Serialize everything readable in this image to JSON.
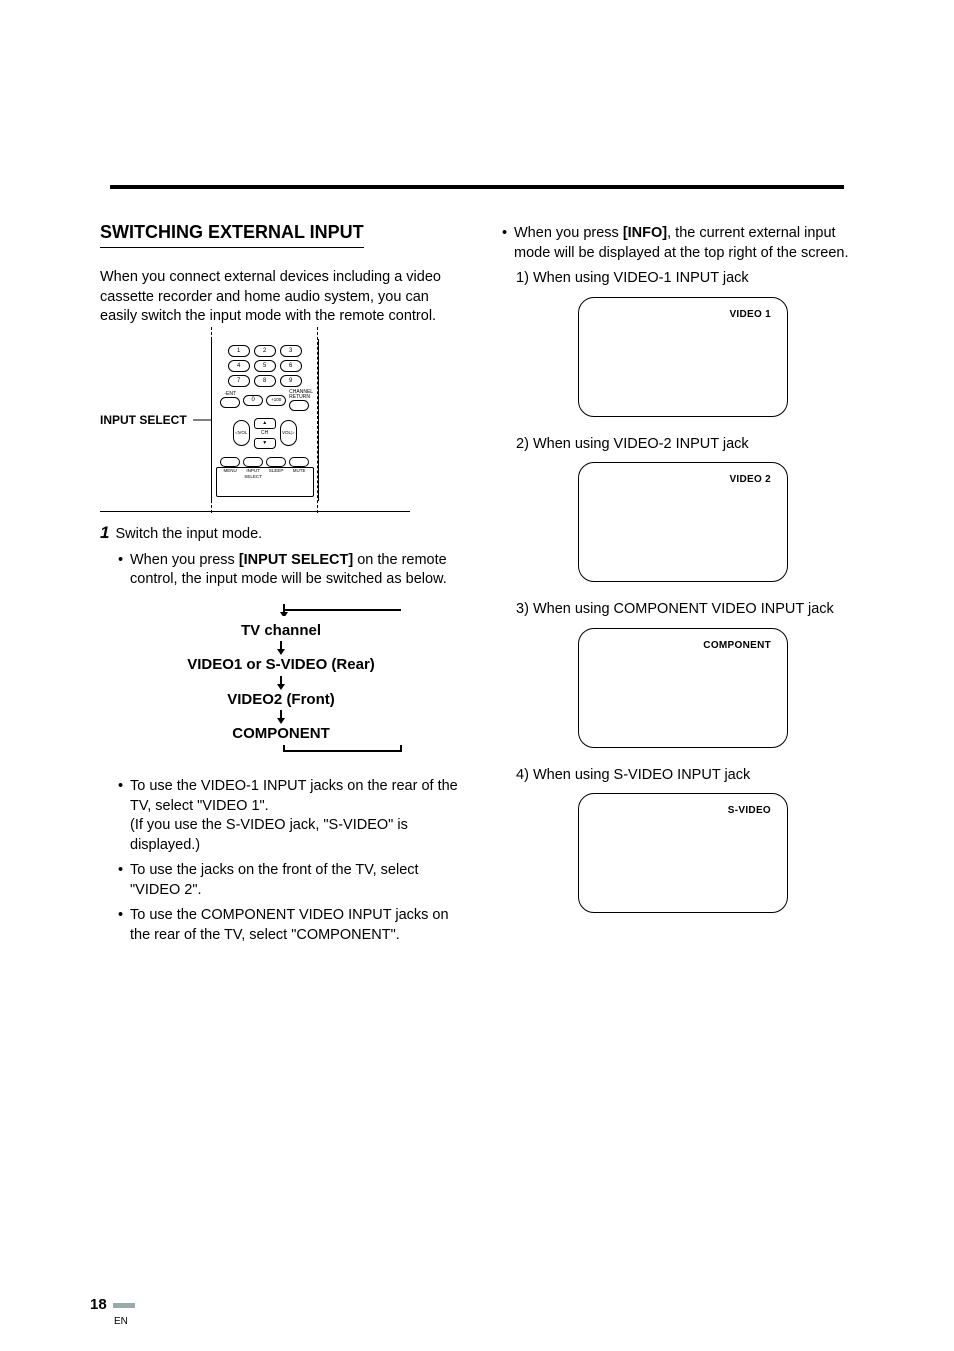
{
  "section": {
    "title": "SWITCHING EXTERNAL INPUT",
    "intro": "When you connect external devices including a video cassette recorder and home audio system, you can easily switch the input mode with the remote control."
  },
  "remote": {
    "callout_label": "INPUT SELECT",
    "numpad": [
      "1",
      "2",
      "3",
      "4",
      "5",
      "6",
      "7",
      "8",
      "9"
    ],
    "row4": {
      "left_label": "-ENT",
      "zero": "0",
      "plus100": "+100",
      "right_label": "CHANNEL\nRETURN"
    },
    "ch": {
      "up": "▲",
      "down": "▼",
      "label": "CH"
    },
    "vol_left": "◁VOL",
    "vol_right": "VOL▷",
    "bottom_buttons": [
      "MENU",
      "INPUT\nSELECT",
      "SLEEP",
      "MUTE"
    ]
  },
  "step1": {
    "number": "1",
    "text": "Switch the input mode.",
    "bullet_input_select_pre": "When you press ",
    "bullet_input_select_key": "[INPUT SELECT]",
    "bullet_input_select_post": " on the remote control, the input mode will be switched as below."
  },
  "mode_cycle": {
    "m1": "TV channel",
    "m2_a": "VIDEO1",
    "m2_b": "or S-VIDEO (Rear)",
    "m3_a": "VIDEO2",
    "m3_b": "(Front)",
    "m4": "COMPONENT"
  },
  "left_bullets": {
    "b1": "To use the VIDEO-1 INPUT jacks on the rear of the TV, select \"VIDEO 1\".",
    "b1_note": "(If you use the S-VIDEO jack, \"S-VIDEO\" is displayed.)",
    "b2": "To use the jacks on the front of the TV, select \"VIDEO 2\".",
    "b3": "To use the COMPONENT VIDEO INPUT jacks on the rear of the TV, select \"COMPONENT\"."
  },
  "right_col": {
    "info_pre": "When you press ",
    "info_key": "[INFO]",
    "info_post": ", the current external input mode will be displayed at the top right of the screen.",
    "items": [
      {
        "num": "1)",
        "text": "When using VIDEO-1 INPUT jack",
        "osd": "VIDEO 1"
      },
      {
        "num": "2)",
        "text": "When using VIDEO-2 INPUT jack",
        "osd": "VIDEO 2"
      },
      {
        "num": "3)",
        "text": "When using COMPONENT VIDEO INPUT jack",
        "osd": "COMPONENT"
      },
      {
        "num": "4)",
        "text": "When using S-VIDEO INPUT jack",
        "osd": "S-VIDEO"
      }
    ]
  },
  "footer": {
    "page_number": "18",
    "lang": "EN"
  }
}
